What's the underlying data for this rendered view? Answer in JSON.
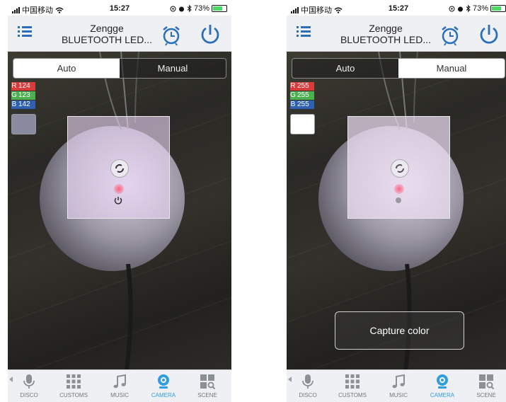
{
  "status_bar": {
    "carrier": "中国移动",
    "time": "15:27",
    "battery": "73%"
  },
  "header": {
    "title_line1": "Zengge",
    "title_line2": "BLUETOOTH LED..."
  },
  "mode_toggle": {
    "auto_label": "Auto",
    "manual_label": "Manual"
  },
  "tabs": [
    {
      "label": "DISCO",
      "icon": "microphone-icon"
    },
    {
      "label": "CUSTOMS",
      "icon": "grid-icon"
    },
    {
      "label": "MUSIC",
      "icon": "music-note-icon"
    },
    {
      "label": "CAMERA",
      "icon": "webcam-icon"
    },
    {
      "label": "SCENE",
      "icon": "scene-icon"
    }
  ],
  "screens": [
    {
      "active_mode": "Auto",
      "rgb": {
        "r_label": "R",
        "r": "124",
        "g_label": "G",
        "g": "123",
        "b_label": "B",
        "b": "142"
      },
      "swatch_color": "#8a8ba0"
    },
    {
      "active_mode": "Manual",
      "rgb": {
        "r_label": "R",
        "r": "255",
        "g_label": "G",
        "g": "255",
        "b_label": "B",
        "b": "255"
      },
      "swatch_color": "#ffffff",
      "capture_button_label": "Capture color"
    }
  ],
  "colors": {
    "accent_blue": "#2a6fb8",
    "tab_active": "#2f9ee0",
    "rgb_red": "#d93a3a",
    "rgb_green": "#4caf50",
    "rgb_blue": "#2e5fb0"
  }
}
